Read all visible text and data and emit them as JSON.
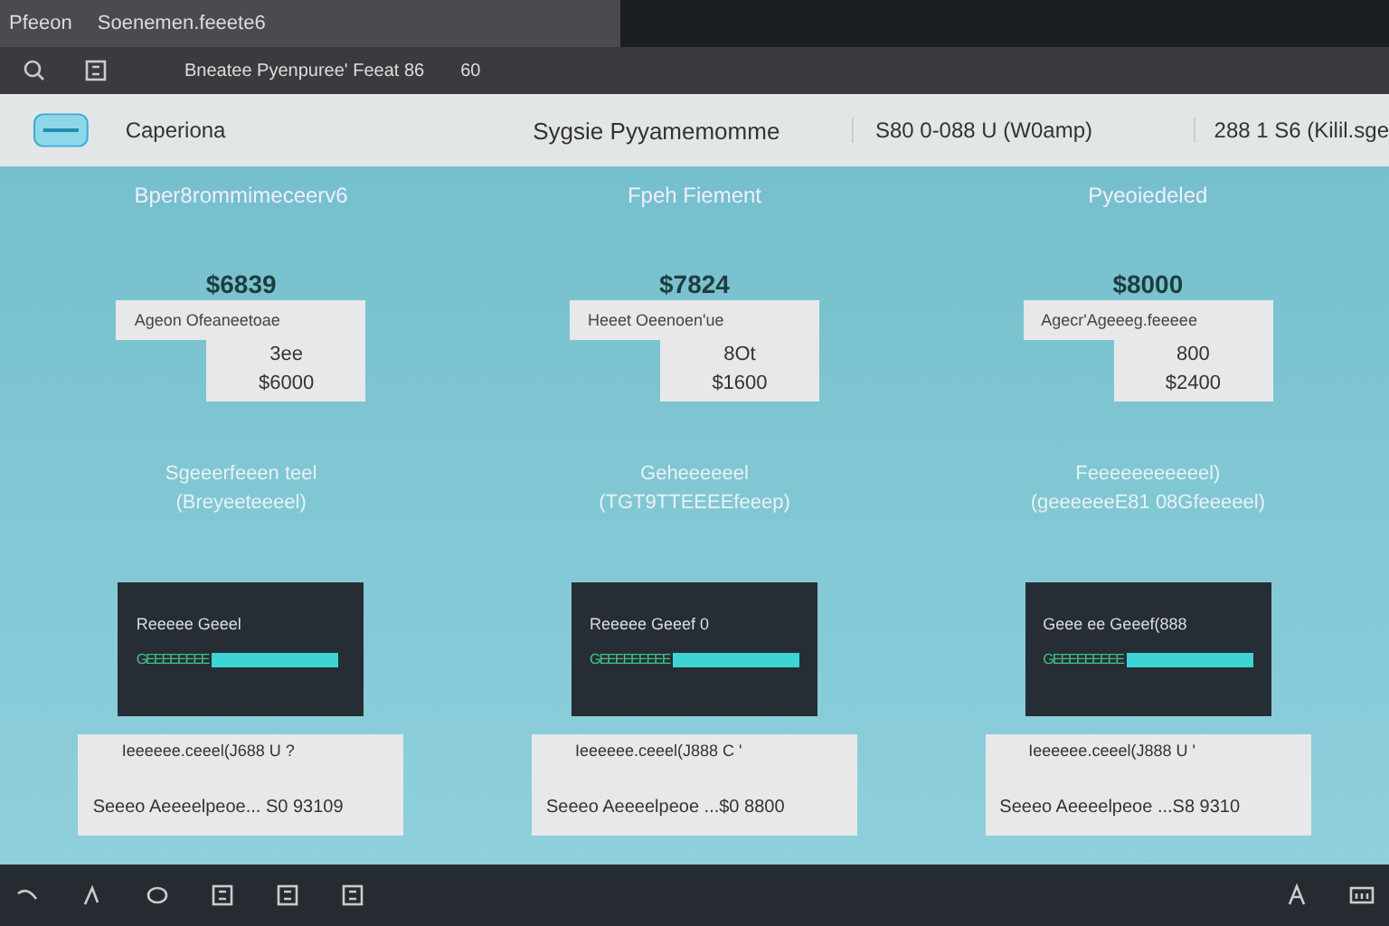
{
  "window": {
    "tab_title": "Pfeeon",
    "tab_subtitle": "Soenemen.feeete6"
  },
  "toolbar": {
    "breadcrumb": "Bneatee Pyenpuree' Feeat 86",
    "count": "60"
  },
  "header": {
    "brand": "Caperiona",
    "title": "Sygsie Pyyamemomme",
    "stat_1": "S80 0-088 U (W0amp)",
    "stat_2": "288 1 S6 (Kilil.sge"
  },
  "columns": [
    {
      "heading": "Bper8rommimeceerv6",
      "price": "$6839",
      "card_label": "Ageon Ofeaneetoae",
      "card_qty": "3ee",
      "card_total": "$6000",
      "caption_1": "Sgeeerfeeen teel",
      "caption_2": "(Breyeeteeeel)",
      "panel_label": "Reeeee Geeel",
      "bar_label": "GEEEEEEEE",
      "level": 1,
      "note": "Ieeeeee.ceeel(J688 U ?",
      "summary": "Seeeo Aeeeelpeoe... S0 93109"
    },
    {
      "heading": "Fpeh Fiement",
      "price": "$7824",
      "card_label": "Heeet Oeenoen'ue",
      "card_qty": "8Ot",
      "card_total": "$1600",
      "caption_1": "Geheeeeeel",
      "caption_2": "(TGT9TTEEEEfeeep)",
      "panel_label": "Reeeee Geeef 0",
      "bar_label": "GEEEEEEEEE",
      "level": 1,
      "note": "Ieeeeee.ceeel(J888 C '",
      "summary": "Seeeo Aeeeelpeoe ...$0 8800"
    },
    {
      "heading": "Pyeoiedeled",
      "price": "$8000",
      "card_label": "Agecr'Ageeeg.feeeee",
      "card_qty": "800",
      "card_total": "$2400",
      "caption_1": "Feeeeeeeeeeel)",
      "caption_2": "(geeeeeeE81 08Gfeeeeel)",
      "panel_label": "Geee ee Geeef(888",
      "bar_label": "GEEEEEEEEE",
      "level": 1,
      "note": "Ieeeeee.ceeel(J888 U '",
      "summary": "Seeeo Aeeeelpeoe ...S8 9310"
    }
  ]
}
